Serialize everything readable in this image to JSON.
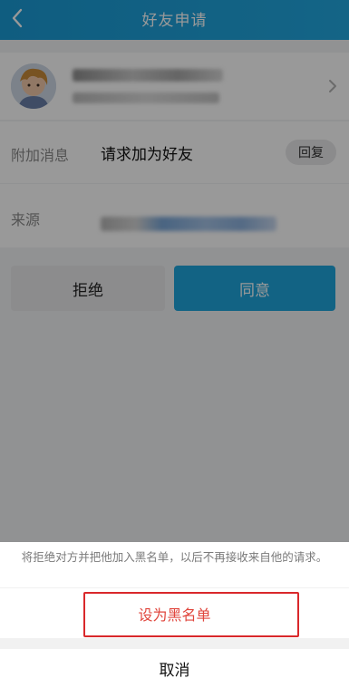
{
  "header": {
    "title": "好友申请",
    "back_icon": "chevron-left-icon"
  },
  "profile": {
    "avatar_icon": "avatar-portrait",
    "chevron_icon": "chevron-right-icon"
  },
  "message": {
    "label": "附加消息",
    "text": "请求加为好友",
    "reply_label": "回复"
  },
  "source": {
    "label": "来源"
  },
  "actions": {
    "reject_label": "拒绝",
    "accept_label": "同意"
  },
  "sheet": {
    "tip": "将拒绝对方并把他加入黑名单，以后不再接收来自他的请求。",
    "blacklist_label": "设为黑名单",
    "cancel_label": "取消"
  },
  "colors": {
    "header": "#1a9bd6",
    "accept": "#1fa6dd",
    "danger": "#e0453c",
    "highlight": "#d9282b"
  }
}
